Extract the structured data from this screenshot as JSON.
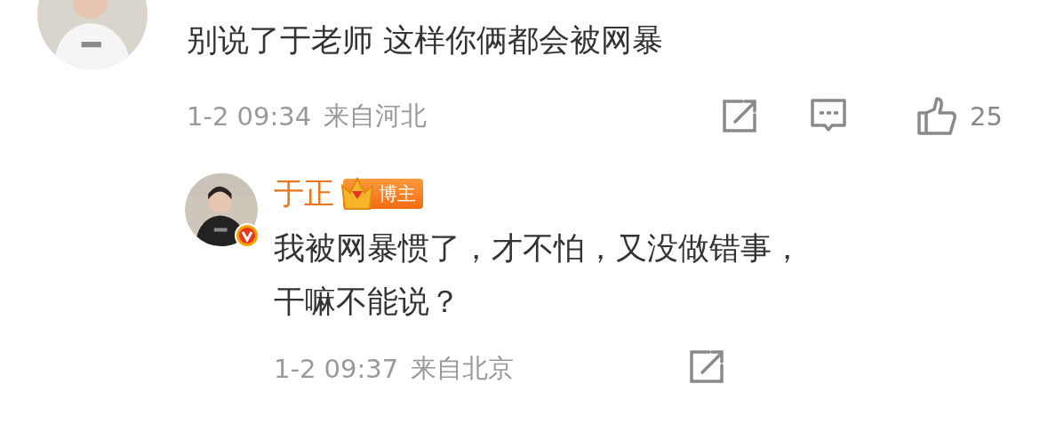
{
  "comment": {
    "text": "别说了于老师 这样你俩都会被网暴",
    "time": "1-2 09:34",
    "location": "来自河北",
    "like_count": "25"
  },
  "reply": {
    "author": "于正",
    "badge": "博主",
    "verified": true,
    "lines": [
      "我被网暴惯了，才不怕，又没做错事，",
      "干嘛不能说？"
    ],
    "time": "1-2 09:37",
    "location": "来自北京"
  }
}
